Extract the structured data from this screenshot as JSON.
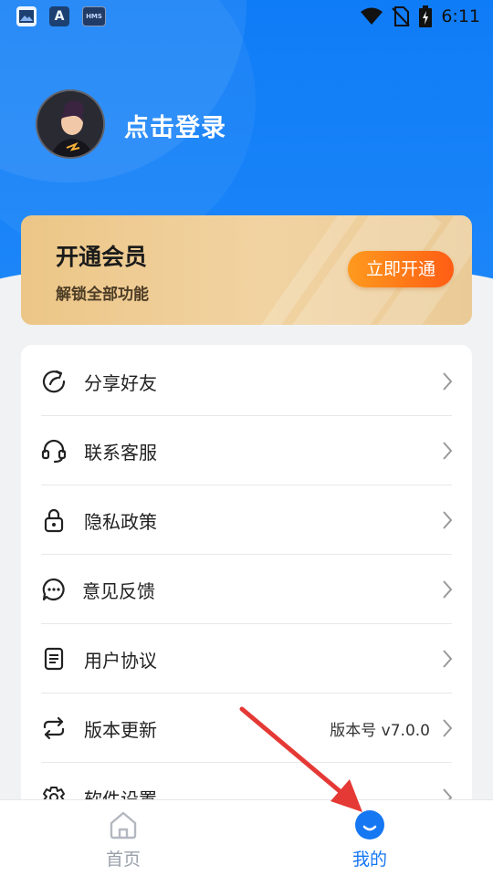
{
  "status_bar": {
    "time": "6:11",
    "left_icons": [
      "image-icon",
      "a-app-icon",
      "hms-icon"
    ],
    "hms_label": "HMS",
    "a_label": "A",
    "right_icons": [
      "wifi-icon",
      "no-sim-icon",
      "battery-charging-icon"
    ]
  },
  "profile": {
    "login_text": "点击登录"
  },
  "vip": {
    "title": "开通会员",
    "subtitle": "解锁全部功能",
    "button_label": "立即开通"
  },
  "menu": {
    "items": [
      {
        "label": "分享好友",
        "icon": "share-icon",
        "value": ""
      },
      {
        "label": "联系客服",
        "icon": "headset-icon",
        "value": ""
      },
      {
        "label": "隐私政策",
        "icon": "lock-icon",
        "value": ""
      },
      {
        "label": "意见反馈",
        "icon": "chat-bubble-icon",
        "value": ""
      },
      {
        "label": "用户协议",
        "icon": "document-icon",
        "value": ""
      },
      {
        "label": "版本更新",
        "icon": "refresh-icon",
        "value": "版本号 v7.0.0"
      },
      {
        "label": "软件设置",
        "icon": "settings-gear-icon",
        "value": ""
      }
    ]
  },
  "tabbar": {
    "tabs": [
      {
        "label": "首页",
        "icon": "home-icon",
        "active": false
      },
      {
        "label": "我的",
        "icon": "smile-circle-icon",
        "active": true
      }
    ]
  },
  "colors": {
    "primary": "#1677f2",
    "vip_gold": "#ecc687",
    "vip_button": "#ff6a17",
    "annotation_red": "#e53935"
  }
}
